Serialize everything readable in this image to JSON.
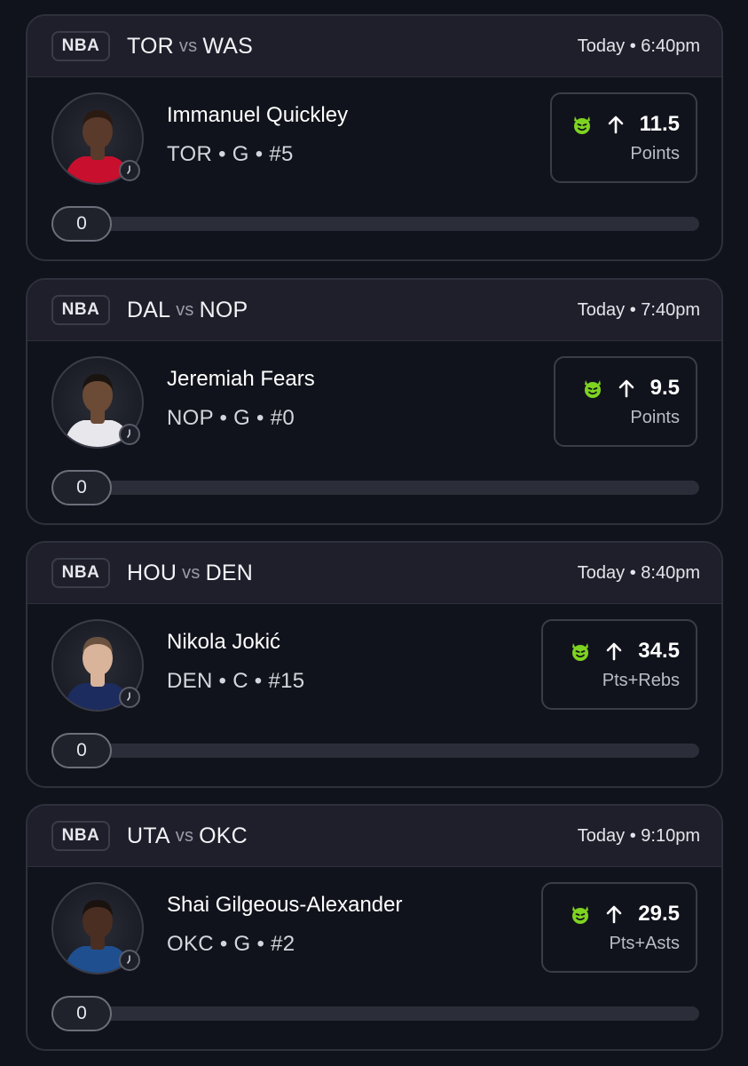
{
  "colors": {
    "accent_green": "#7ed321",
    "card_header": "#1e1f2a",
    "background": "#11131c"
  },
  "icons": {
    "pick_icon": "devil-icon",
    "direction_icon": "arrow-up-icon",
    "status_icon": "clock-icon"
  },
  "cards": [
    {
      "league": "NBA",
      "team_a": "TOR",
      "vs": "vs",
      "team_b": "WAS",
      "time": "Today • 6:40pm",
      "player_name": "Immanuel Quickley",
      "player_meta": "TOR • G • #5",
      "line": "11.5",
      "stat": "Points",
      "progress_value": "0",
      "jersey_color": "#c8102e",
      "skin_color": "#5a3a2a",
      "hair_color": "#2a1a12"
    },
    {
      "league": "NBA",
      "team_a": "DAL",
      "vs": "vs",
      "team_b": "NOP",
      "time": "Today • 7:40pm",
      "player_name": "Jeremiah Fears",
      "player_meta": "NOP • G • #0",
      "line": "9.5",
      "stat": "Points",
      "progress_value": "0",
      "jersey_color": "#e8e8ec",
      "skin_color": "#6b4a36",
      "hair_color": "#1a1410"
    },
    {
      "league": "NBA",
      "team_a": "HOU",
      "vs": "vs",
      "team_b": "DEN",
      "time": "Today • 8:40pm",
      "player_name": "Nikola Jokić",
      "player_meta": "DEN • C • #15",
      "line": "34.5",
      "stat": "Pts+Rebs",
      "progress_value": "0",
      "jersey_color": "#1d2c5e",
      "skin_color": "#d9b39a",
      "hair_color": "#6b5240"
    },
    {
      "league": "NBA",
      "team_a": "UTA",
      "vs": "vs",
      "team_b": "OKC",
      "time": "Today • 9:10pm",
      "player_name": "Shai Gilgeous-Alexander",
      "player_meta": "OKC • G • #2",
      "line": "29.5",
      "stat": "Pts+Asts",
      "progress_value": "0",
      "jersey_color": "#1f4f8f",
      "skin_color": "#4a2e22",
      "hair_color": "#1a120e"
    }
  ]
}
